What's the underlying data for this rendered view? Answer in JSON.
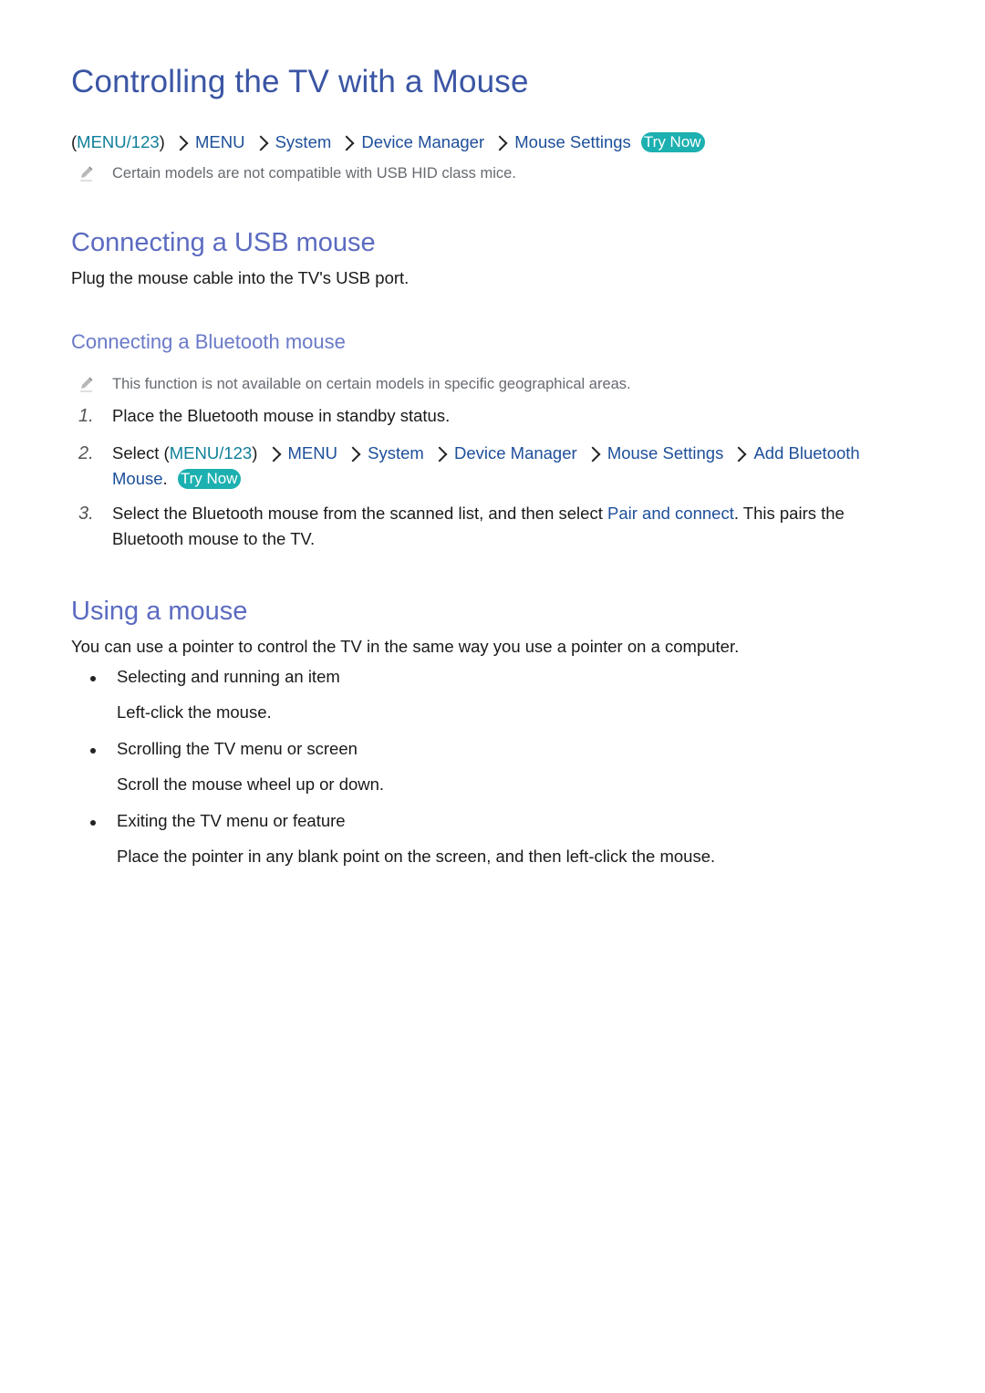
{
  "page": {
    "title": "Controlling the TV with a Mouse",
    "nav_path": {
      "open": "(",
      "root": "MENU/123",
      "close": ")",
      "items": [
        "MENU",
        "System",
        "Device Manager",
        "Mouse Settings"
      ],
      "try_now": "Try Now"
    },
    "note1": "Certain models are not compatible with USB HID class mice.",
    "usb_section": {
      "heading": "Connecting a USB mouse",
      "text": "Plug the mouse cable into the TV's USB port."
    },
    "bt_section": {
      "heading": "Connecting a Bluetooth mouse",
      "note": "This function is not available on certain models in specific geographical areas.",
      "steps": [
        {
          "num": "1.",
          "text": "Place the Bluetooth mouse in standby status."
        },
        {
          "num": "2.",
          "prefix": "Select (",
          "root": "MENU/123",
          "close": ")",
          "items": [
            "MENU",
            "System",
            "Device Manager",
            "Mouse Settings",
            "Add Bluetooth Mouse"
          ],
          "suffix": ".",
          "try_now": "Try Now"
        },
        {
          "num": "3.",
          "text_before": "Select the Bluetooth mouse from the scanned list, and then select ",
          "link": "Pair and connect",
          "text_after": ". This pairs the Bluetooth mouse to the TV."
        }
      ]
    },
    "using_section": {
      "heading": "Using a mouse",
      "intro": "You can use a pointer to control the TV in the same way you use a pointer on a computer.",
      "bullets": [
        {
          "title": "Selecting and running an item",
          "desc": "Left-click the mouse."
        },
        {
          "title": "Scrolling the TV menu or screen",
          "desc": "Scroll the mouse wheel up or down."
        },
        {
          "title": "Exiting the TV menu or feature",
          "desc": "Place the pointer in any blank point on the screen, and then left-click the mouse."
        }
      ]
    }
  },
  "colors": {
    "title": "#3a55a4",
    "section_heading": "#5b6bc0",
    "link": "#1d4f9a",
    "menu_root": "#0e7f9a",
    "try_now_bg": "#1db0b0"
  }
}
